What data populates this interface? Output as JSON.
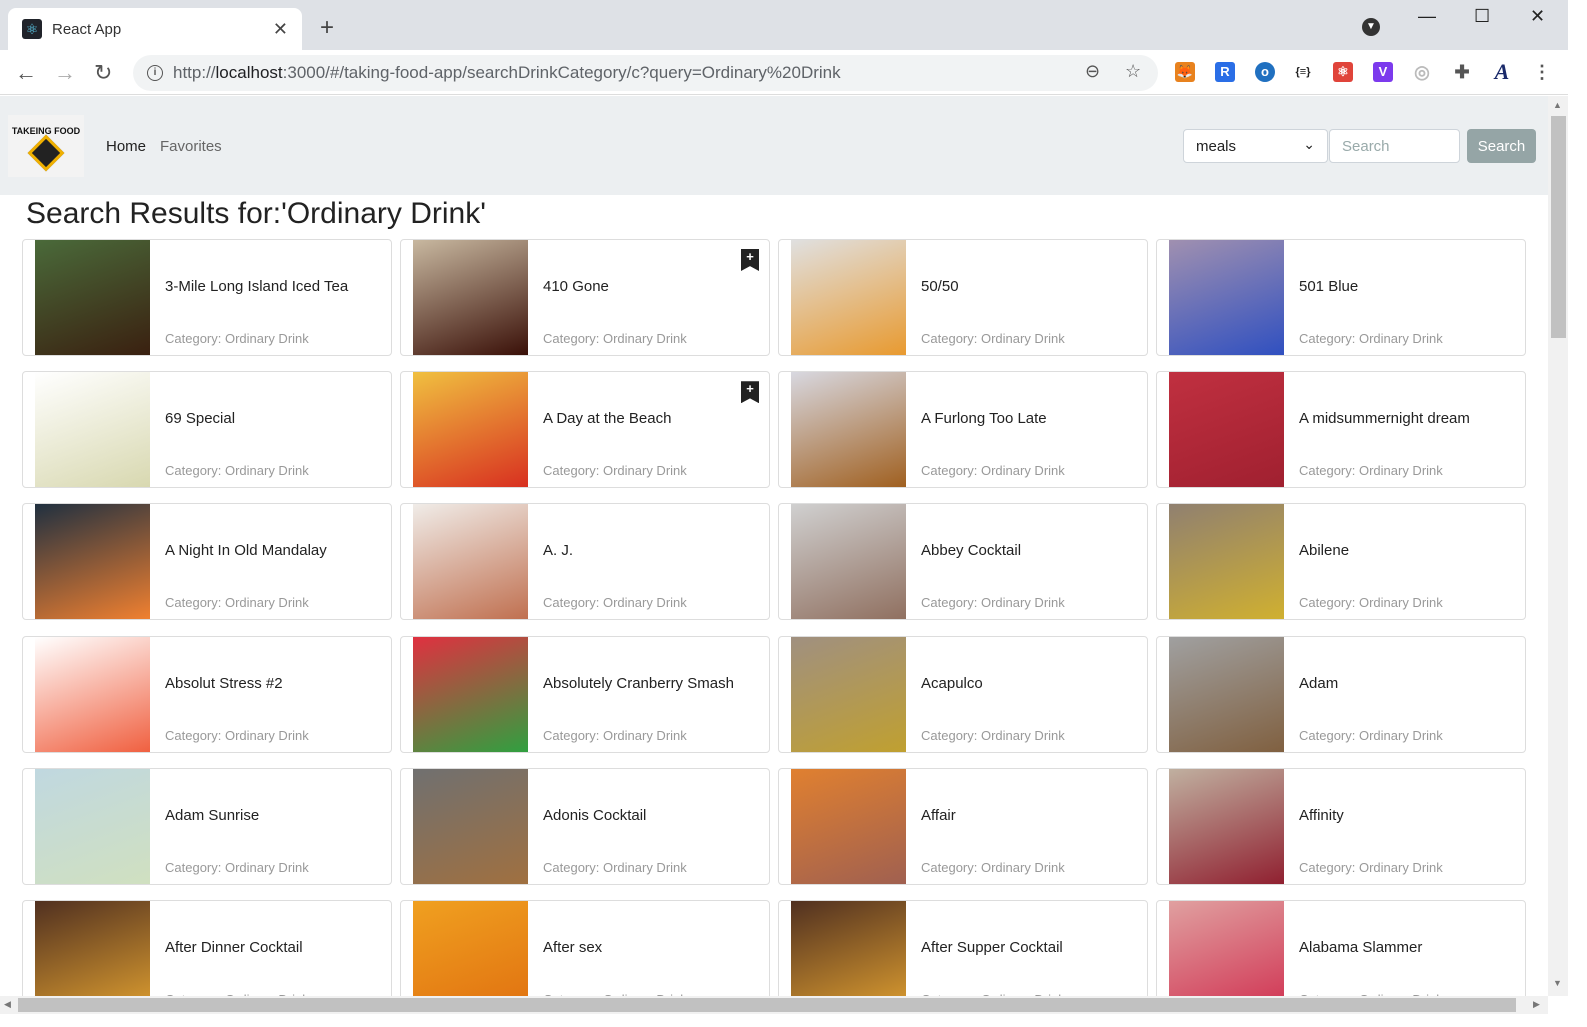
{
  "browser": {
    "tab_title": "React App",
    "url_prefix": "http://",
    "url_host": "localhost",
    "url_rest": ":3000/#/taking-food-app/searchDrinkCategory/c?query=Ordinary%20Drink"
  },
  "nav": {
    "logo_text": "TAKEING FOOD",
    "home": "Home",
    "favorites": "Favorites",
    "select_value": "meals",
    "search_placeholder": "Search",
    "search_button": "Search"
  },
  "results_title": "Search Results for:'Ordinary Drink'",
  "category_label": "Category: Ordinary Drink",
  "drinks": [
    {
      "name": "3-Mile Long Island Iced Tea",
      "c1": "#4a6a3a",
      "c2": "#3a2010",
      "bookmark": false
    },
    {
      "name": "410 Gone",
      "c1": "#c8b8a0",
      "c2": "#3a1008",
      "bookmark": true
    },
    {
      "name": "50/50",
      "c1": "#e0e0e0",
      "c2": "#e89a30",
      "bookmark": false
    },
    {
      "name": "501 Blue",
      "c1": "#a090b0",
      "c2": "#3050c0",
      "bookmark": false
    },
    {
      "name": "69 Special",
      "c1": "#ffffff",
      "c2": "#d8d8b0",
      "bookmark": false
    },
    {
      "name": "A Day at the Beach",
      "c1": "#f0c040",
      "c2": "#d83020",
      "bookmark": true
    },
    {
      "name": "A Furlong Too Late",
      "c1": "#d8d8e0",
      "c2": "#a06020",
      "bookmark": false
    },
    {
      "name": "A midsummernight dream",
      "c1": "#c03040",
      "c2": "#a02030",
      "bookmark": false
    },
    {
      "name": "A Night In Old Mandalay",
      "c1": "#203040",
      "c2": "#f08030",
      "bookmark": false
    },
    {
      "name": "A. J.",
      "c1": "#f0ece8",
      "c2": "#c07050",
      "bookmark": false
    },
    {
      "name": "Abbey Cocktail",
      "c1": "#d0d0d0",
      "c2": "#907060",
      "bookmark": false
    },
    {
      "name": "Abilene",
      "c1": "#908070",
      "c2": "#d0b030",
      "bookmark": false
    },
    {
      "name": "Absolut Stress #2",
      "c1": "#ffffff",
      "c2": "#f06040",
      "bookmark": false
    },
    {
      "name": "Absolutely Cranberry Smash",
      "c1": "#e03040",
      "c2": "#30a040",
      "bookmark": false
    },
    {
      "name": "Acapulco",
      "c1": "#a09080",
      "c2": "#c0a030",
      "bookmark": false
    },
    {
      "name": "Adam",
      "c1": "#a0a0a0",
      "c2": "#806040",
      "bookmark": false
    },
    {
      "name": "Adam Sunrise",
      "c1": "#c0d8e0",
      "c2": "#d0e0c0",
      "bookmark": false
    },
    {
      "name": "Adonis Cocktail",
      "c1": "#707070",
      "c2": "#a07040",
      "bookmark": false
    },
    {
      "name": "Affair",
      "c1": "#e08030",
      "c2": "#a06050",
      "bookmark": false
    },
    {
      "name": "Affinity",
      "c1": "#c0b0a0",
      "c2": "#902030",
      "bookmark": false
    },
    {
      "name": "After Dinner Cocktail",
      "c1": "#503020",
      "c2": "#e0a030",
      "bookmark": false
    },
    {
      "name": "After sex",
      "c1": "#f0a020",
      "c2": "#e07010",
      "bookmark": false
    },
    {
      "name": "After Supper Cocktail",
      "c1": "#503020",
      "c2": "#e0a030",
      "bookmark": false
    },
    {
      "name": "Alabama Slammer",
      "c1": "#e0a0a0",
      "c2": "#d03050",
      "bookmark": false
    }
  ]
}
